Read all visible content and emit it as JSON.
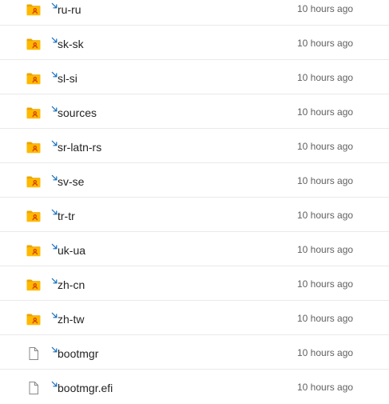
{
  "files": [
    {
      "name": "ru-ru",
      "modified": "10 hours ago",
      "icon": "shared-folder-icon"
    },
    {
      "name": "sk-sk",
      "modified": "10 hours ago",
      "icon": "shared-folder-icon"
    },
    {
      "name": "sl-si",
      "modified": "10 hours ago",
      "icon": "shared-folder-icon"
    },
    {
      "name": "sources",
      "modified": "10 hours ago",
      "icon": "shared-folder-icon"
    },
    {
      "name": "sr-latn-rs",
      "modified": "10 hours ago",
      "icon": "shared-folder-icon"
    },
    {
      "name": "sv-se",
      "modified": "10 hours ago",
      "icon": "shared-folder-icon"
    },
    {
      "name": "tr-tr",
      "modified": "10 hours ago",
      "icon": "shared-folder-icon"
    },
    {
      "name": "uk-ua",
      "modified": "10 hours ago",
      "icon": "shared-folder-icon"
    },
    {
      "name": "zh-cn",
      "modified": "10 hours ago",
      "icon": "shared-folder-icon"
    },
    {
      "name": "zh-tw",
      "modified": "10 hours ago",
      "icon": "shared-folder-icon"
    },
    {
      "name": "bootmgr",
      "modified": "10 hours ago",
      "icon": "file-icon"
    },
    {
      "name": "bootmgr.efi",
      "modified": "10 hours ago",
      "icon": "file-icon"
    }
  ],
  "colors": {
    "folder_body": "#FFB900",
    "folder_back": "#E8A500",
    "shared_person": "#D83B01",
    "new_badge": "#0F6CBD",
    "file_outline": "#8A8886",
    "divider": "#E9E9E9",
    "secondary_text": "#616161"
  }
}
